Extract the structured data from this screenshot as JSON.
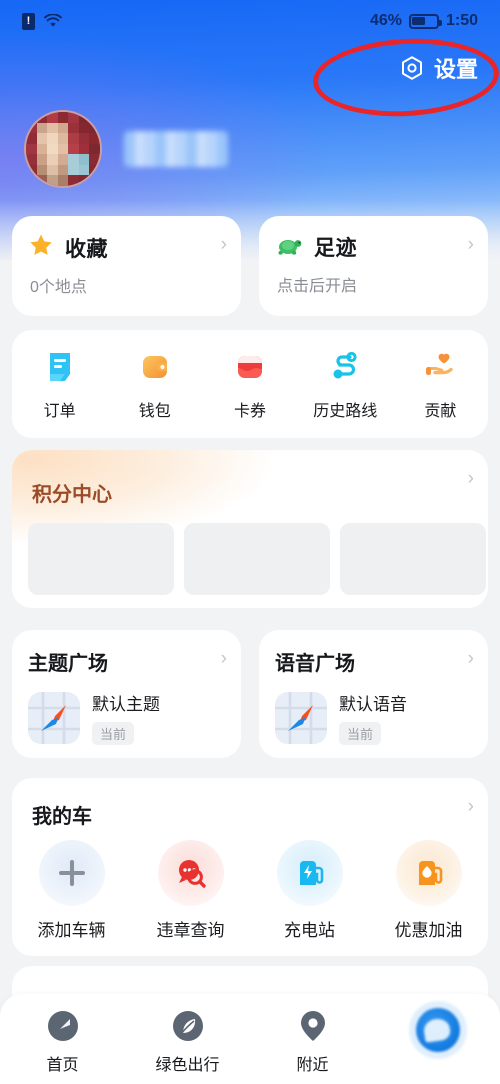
{
  "statusbar": {
    "battery_percent": "46%",
    "time": "1:50",
    "sim_icon": "sim-alert-icon",
    "wifi_icon": "wifi-icon",
    "battery_icon": "battery-icon"
  },
  "header": {
    "settings_label": "设置",
    "settings_icon": "hexagon-gear-icon",
    "username_redacted": "",
    "avatar_redacted": ""
  },
  "annotation": {
    "shape": "red-ellipse-highlight",
    "color": "#e8262a"
  },
  "feature_cards": [
    {
      "title": "收藏",
      "subtitle": "0个地点",
      "icon": "star-icon",
      "chevron": "›"
    },
    {
      "title": "足迹",
      "subtitle": "点击后开启",
      "icon": "turtle-icon",
      "chevron": "›"
    }
  ],
  "quick_actions": [
    {
      "label": "订单",
      "icon": "receipt-icon",
      "color": "#2ec2f5"
    },
    {
      "label": "钱包",
      "icon": "wallet-icon",
      "color": "#f8a13c"
    },
    {
      "label": "卡券",
      "icon": "coupon-icon",
      "color": "#ee3b3b"
    },
    {
      "label": "历史路线",
      "icon": "route-icon",
      "color": "#17c3e8"
    },
    {
      "label": "贡献",
      "icon": "hand-heart-icon",
      "color": "#f7923a"
    }
  ],
  "points_center": {
    "title": "积分中心",
    "chevron": "›",
    "placeholder_count": 3,
    "accent": "#9c4b27"
  },
  "market_cards": [
    {
      "title": "主题广场",
      "item_name": "默认主题",
      "badge": "当前",
      "icon": "map-compass-icon",
      "chevron": "›"
    },
    {
      "title": "语音广场",
      "item_name": "默认语音",
      "badge": "当前",
      "icon": "map-compass-icon",
      "chevron": "›"
    }
  ],
  "my_car": {
    "title": "我的车",
    "chevron": "›",
    "items": [
      {
        "label": "添加车辆",
        "icon": "plus-icon",
        "bubble": "#dce9f8"
      },
      {
        "label": "违章查询",
        "icon": "search-chat-icon",
        "bubble": "#fbdcd8"
      },
      {
        "label": "充电站",
        "icon": "charging-station-icon",
        "bubble": "#d6eefb"
      },
      {
        "label": "优惠加油",
        "icon": "fuel-pump-icon",
        "bubble": "#fbe7cf"
      }
    ]
  },
  "bottom_nav": [
    {
      "label": "首页",
      "icon": "compass-icon",
      "active": false
    },
    {
      "label": "绿色出行",
      "icon": "leaf-icon",
      "active": false
    },
    {
      "label": "附近",
      "icon": "location-pin-icon",
      "active": false
    },
    {
      "label": "",
      "icon": "profile-avatar-icon",
      "active": true
    }
  ]
}
